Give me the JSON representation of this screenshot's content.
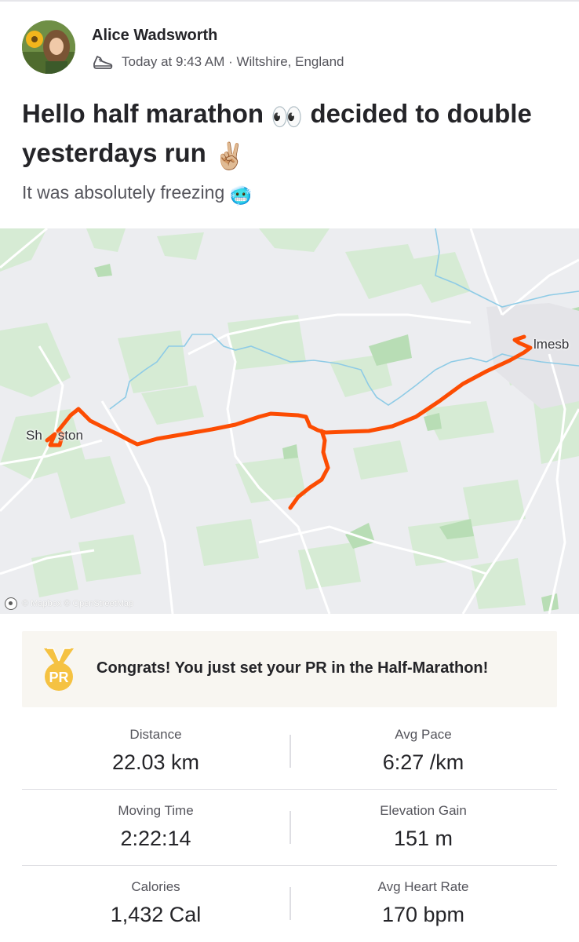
{
  "activity": {
    "athlete_name": "Alice Wadsworth",
    "sport_icon": "running-shoe-icon",
    "timestamp": "Today at 9:43 AM",
    "location": "Wiltshire, England",
    "meta_separator": " · ",
    "title_part1": "Hello half marathon ",
    "title_emoji1": "👀",
    "title_part2": " decided to double yesterdays run ",
    "title_emoji2": "✌🏼",
    "description_text": "It was absolutely freezing ",
    "description_emoji": "🥶"
  },
  "map": {
    "place_labels": [
      "Sh",
      "ston",
      "lmesb"
    ],
    "attribution": "© Mapbox © OpenStreetMap",
    "route_color": "#fc4c02",
    "water_color": "#86c8e8",
    "green_color": "#d6ebd4"
  },
  "achievement": {
    "icon": "pr-medal-icon",
    "badge_text": "PR",
    "message": "Congrats! You just set your PR in the Half-Marathon!",
    "medal_color": "#f5c242"
  },
  "stats": [
    {
      "left_label": "Distance",
      "left_value": "22.03 km",
      "right_label": "Avg Pace",
      "right_value": "6:27 /km"
    },
    {
      "left_label": "Moving Time",
      "left_value": "2:22:14",
      "right_label": "Elevation Gain",
      "right_value": "151 m"
    },
    {
      "left_label": "Calories",
      "left_value": "1,432 Cal",
      "right_label": "Avg Heart Rate",
      "right_value": "170 bpm"
    }
  ]
}
